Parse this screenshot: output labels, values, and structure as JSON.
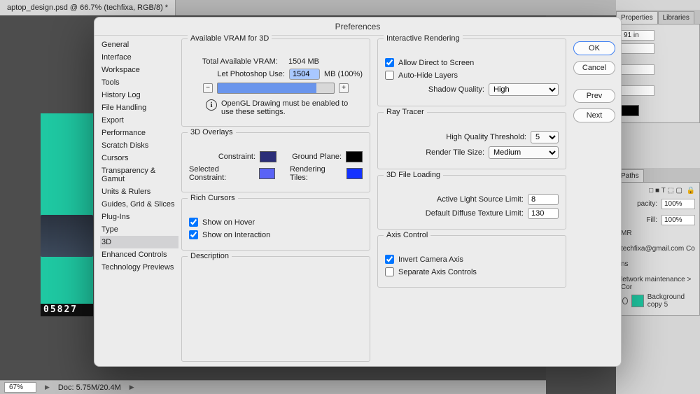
{
  "doc_tab": "aptop_design.psd @ 66.7% (techfixa, RGB/8) *",
  "art_banner": "05827",
  "status": {
    "zoom": "67%",
    "doc": "Doc: 5.75M/20.4M"
  },
  "dialog": {
    "title": "Preferences",
    "sidebar": [
      "General",
      "Interface",
      "Workspace",
      "Tools",
      "History Log",
      "File Handling",
      "Export",
      "Performance",
      "Scratch Disks",
      "Cursors",
      "Transparency & Gamut",
      "Units & Rulers",
      "Guides, Grid & Slices",
      "Plug-Ins",
      "Type",
      "3D",
      "Enhanced Controls",
      "Technology Previews"
    ],
    "selected_index": 15,
    "vram": {
      "title": "Available VRAM for 3D",
      "total_label": "Total Available VRAM:",
      "total_value": "1504 MB",
      "use_label": "Let Photoshop Use:",
      "use_value": "1504",
      "use_suffix": "MB (100%)",
      "note": "OpenGL Drawing must be enabled to use these settings."
    },
    "overlays": {
      "title": "3D Overlays",
      "constraint": "Constraint:",
      "ground": "Ground Plane:",
      "sel_constraint": "Selected Constraint:",
      "tiles": "Rendering Tiles:",
      "c_constraint": "#2b2e78",
      "c_ground": "#000000",
      "c_sel": "#5a63f5",
      "c_tiles": "#1432ff"
    },
    "cursors": {
      "title": "Rich Cursors",
      "hover": "Show on Hover",
      "interact": "Show on Interaction"
    },
    "desc_title": "Description",
    "inter": {
      "title": "Interactive Rendering",
      "direct": "Allow Direct to Screen",
      "autohide": "Auto-Hide Layers",
      "shadow_label": "Shadow Quality:",
      "shadow_value": "High"
    },
    "ray": {
      "title": "Ray Tracer",
      "thresh_label": "High Quality Threshold:",
      "thresh_value": "5",
      "tile_label": "Render Tile Size:",
      "tile_value": "Medium"
    },
    "file": {
      "title": "3D File Loading",
      "light_label": "Active Light Source Limit:",
      "light_value": "8",
      "tex_label": "Default Diffuse Texture Limit:",
      "tex_value": "130"
    },
    "axis": {
      "title": "Axis Control",
      "invert": "Invert Camera Axis",
      "separate": "Separate Axis Controls"
    },
    "buttons": {
      "ok": "OK",
      "cancel": "Cancel",
      "prev": "Prev",
      "next": "Next"
    }
  },
  "right": {
    "tab_props": "Properties",
    "tab_libs": "Libraries",
    "w_suffix": "91 in",
    "tab_paths": "Paths",
    "opacity_label": "pacity:",
    "opacity": "100%",
    "fill_label": "Fill:",
    "fill": "100%",
    "mr": "MR",
    "email": "techfixa@gmail.com  Co",
    "ns": "ns",
    "crumb": "letwork maintenance > Cor",
    "layer": "Background copy 5"
  }
}
